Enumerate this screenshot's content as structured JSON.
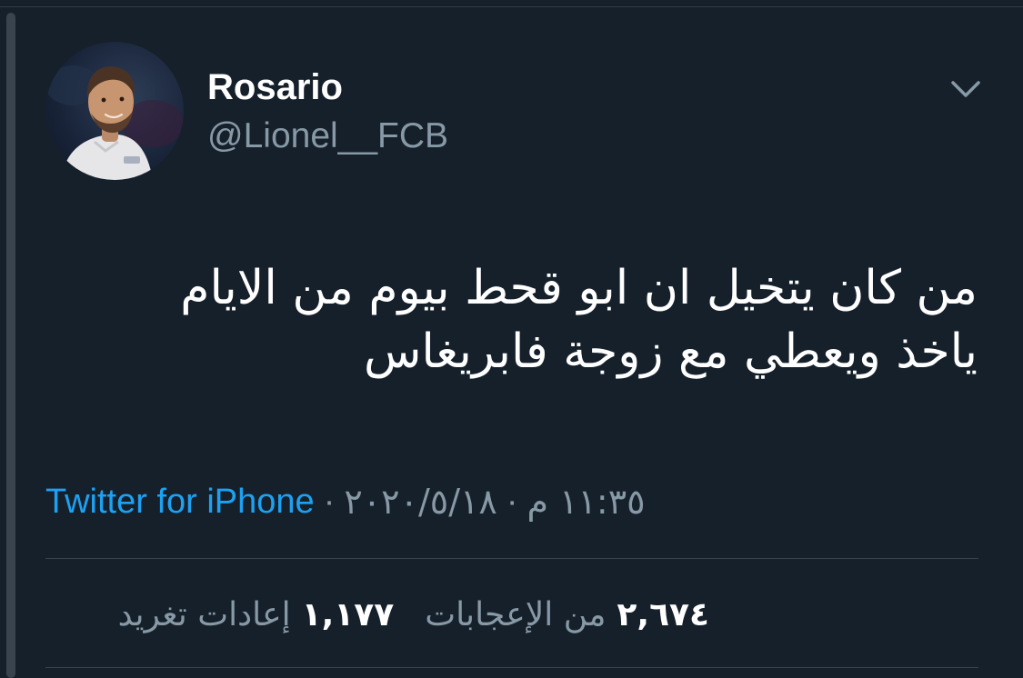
{
  "tweet": {
    "author": {
      "name": "Rosario",
      "handle": "@Lionel__FCB",
      "avatar_icon": "profile-photo"
    },
    "menu_icon": "chevron-down-icon",
    "text_lines": [
      "من كان يتخيل ان ابو قحط بيوم من الايام",
      "ياخذ ويعطي مع زوجة فابريغاس"
    ],
    "meta": {
      "time": "١١:٣٥ م",
      "date": "٢٠٢٠/٥/١٨",
      "source": "Twitter for iPhone",
      "separator": "·"
    },
    "stats": {
      "likes_count": "٢,٦٧٤",
      "likes_label": "من الإعجابات",
      "retweets_count": "١,١٧٧",
      "retweets_label": "إعادات تغريد"
    }
  },
  "colors": {
    "background": "#15202b",
    "primary_text": "#ffffff",
    "secondary_text": "#8899a6",
    "link": "#1da1f2",
    "divider": "#38444d"
  }
}
